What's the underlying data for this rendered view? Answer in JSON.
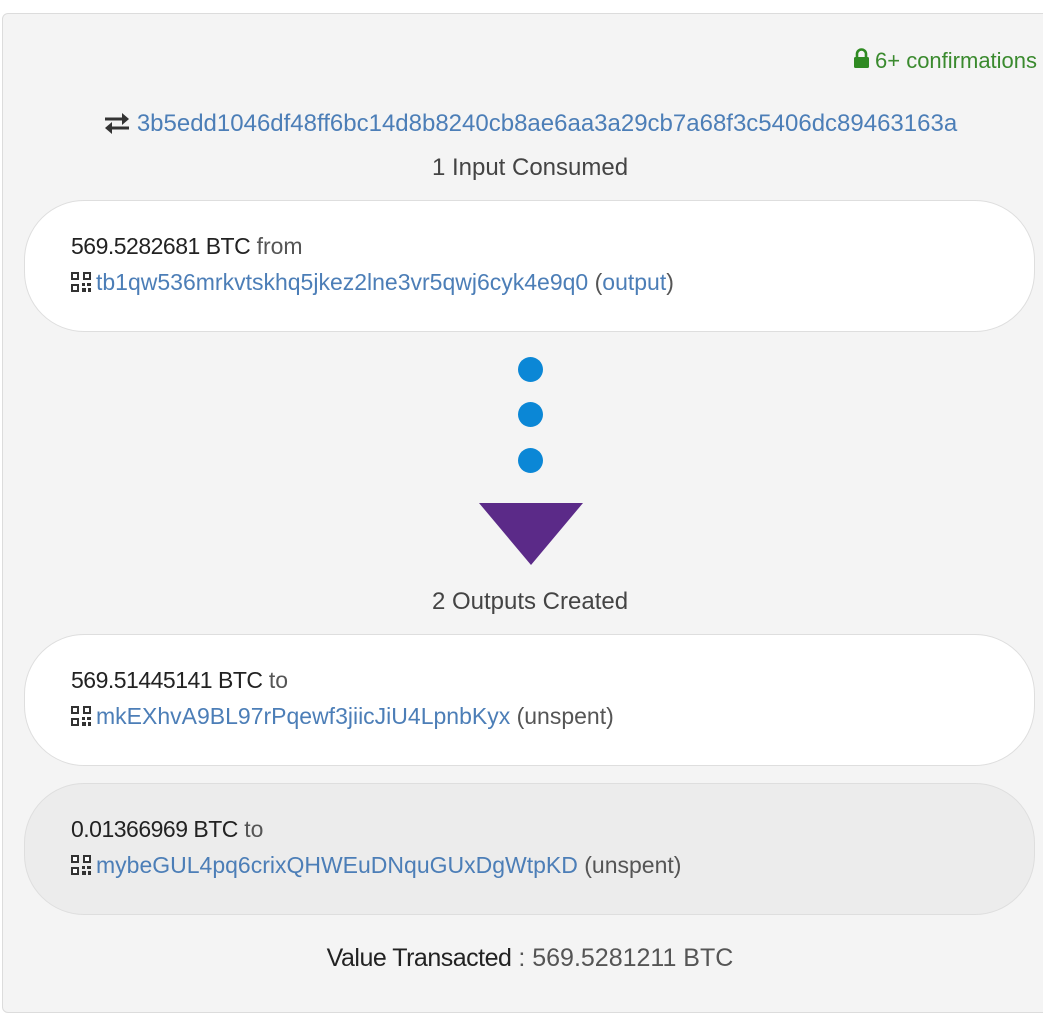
{
  "confirmations": {
    "text": "6+ confirmations",
    "icon": "lock-icon",
    "color": "#3a8a2e"
  },
  "transaction": {
    "icon": "swap-arrows-icon",
    "txid": "3b5edd1046df48ff6bc14d8b8240cb8ae6aa3a29cb7a68f3c5406dc89463163a"
  },
  "inputs": {
    "title": "1 Input Consumed",
    "items": [
      {
        "amount": "569.5282681 BTC",
        "direction": "from",
        "address": "tb1qw536mrkvtskhq5jkez2lne3vr5qwj6cyk4e9q0",
        "link_label": "output",
        "open": "(",
        "close": ")"
      }
    ]
  },
  "flow": {
    "dot_color": "#0b87d6",
    "arrow_color": "#5b2a88"
  },
  "outputs": {
    "title": "2 Outputs Created",
    "items": [
      {
        "amount": "569.51445141 BTC",
        "direction": "to",
        "address": "mkEXhvA9BL97rPqewf3jiicJiU4LpnbKyx",
        "status": "(unspent)"
      },
      {
        "amount": "0.01366969 BTC",
        "direction": "to",
        "address": "mybeGUL4pq6crixQHWEuDNquGUxDgWtpKD",
        "status": "(unspent)"
      }
    ]
  },
  "summary": {
    "label": "Value Transacted",
    "separator": " : ",
    "value": "569.5281211 BTC"
  },
  "colors": {
    "link": "#4c7eb7",
    "panel_bg": "#f4f4f4"
  }
}
